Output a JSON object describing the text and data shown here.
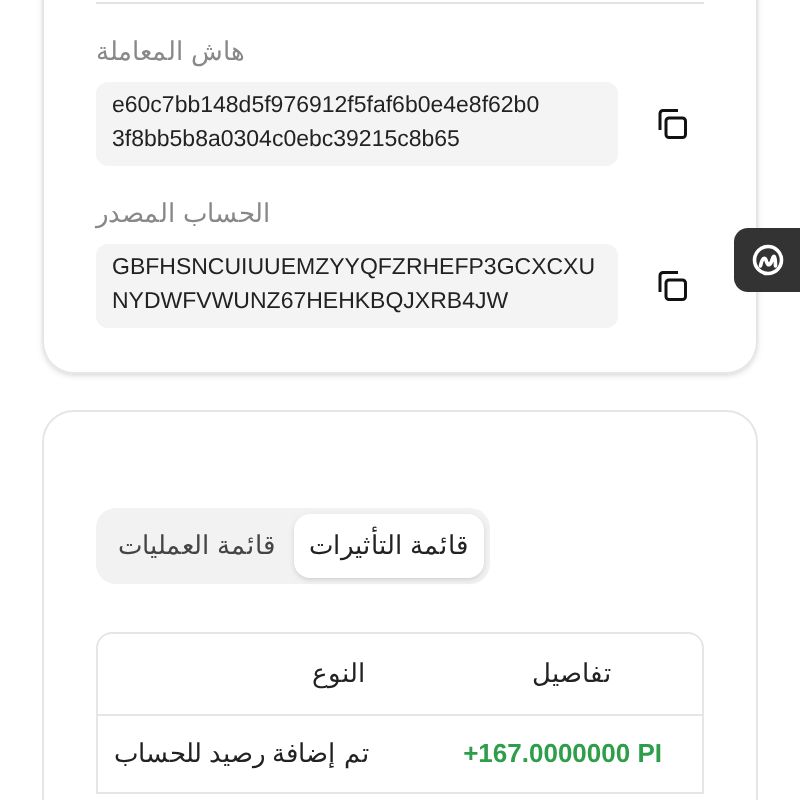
{
  "details": [
    {
      "label": "هاش المعاملة",
      "value": "e60c7bb148d5f976912f5faf6b0e4e8f62b0\n3f8bb5b8a0304c0ebc39215c8b65"
    },
    {
      "label": "الحساب المصدر",
      "value": "GBFHSNCUIUUEMZYYQFZRHEFP3GCXCXU\nNYDWFVWUNZ67HEHKBQJXRB4JW"
    }
  ],
  "tabs": [
    {
      "label": "قائمة التأثيرات",
      "selected": true
    },
    {
      "label": "قائمة العمليات",
      "selected": false
    }
  ],
  "table": {
    "columns": [
      "تفاصيل",
      "النوع"
    ],
    "rows": [
      {
        "type": "تم إضافة رصيد للحساب",
        "details": "+167.0000000 PI"
      }
    ]
  }
}
